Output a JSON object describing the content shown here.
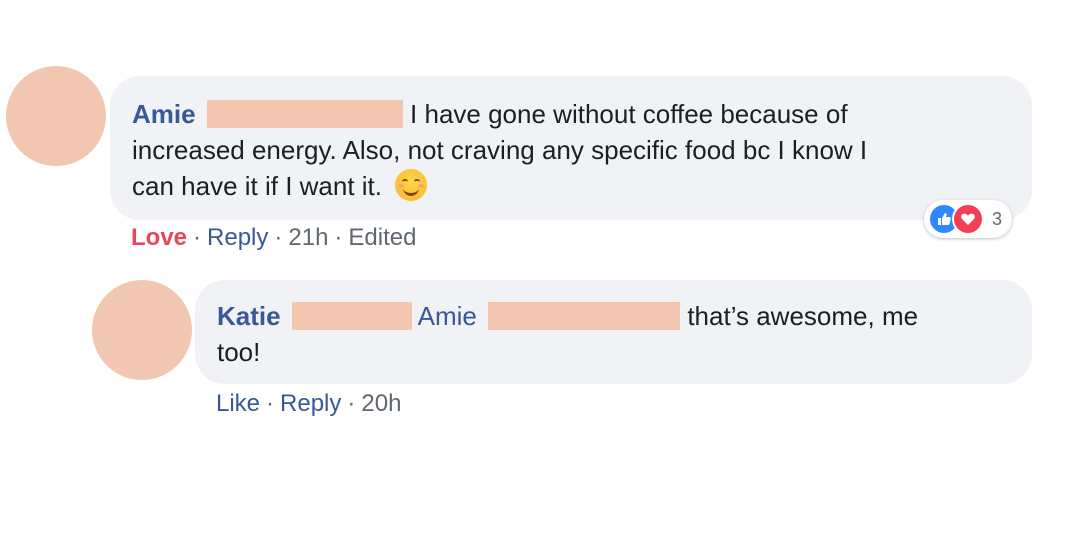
{
  "comments": [
    {
      "author": "Amie",
      "text_line1": "I have gone without coffee because of",
      "text_line2": "increased energy. Also, not craving any specific food bc I know I",
      "text_line3": "can have it if I want it.",
      "emoji_icon": "smiling-face-icon",
      "reactions": {
        "icons": [
          "like-icon",
          "love-icon"
        ],
        "count": "3"
      },
      "actions": {
        "reaction_label": "Love",
        "reply_label": "Reply",
        "time": "21h",
        "edited": "Edited"
      }
    },
    {
      "author": "Katie",
      "mention": "Amie",
      "text_line1": "that’s awesome, me",
      "text_line2": "too!",
      "actions": {
        "like_label": "Like",
        "reply_label": "Reply",
        "time": "20h"
      }
    }
  ],
  "colors": {
    "link": "#385898",
    "love": "#e3485b",
    "bubble": "#f0f2f5",
    "redaction": "#f2c7b2"
  }
}
